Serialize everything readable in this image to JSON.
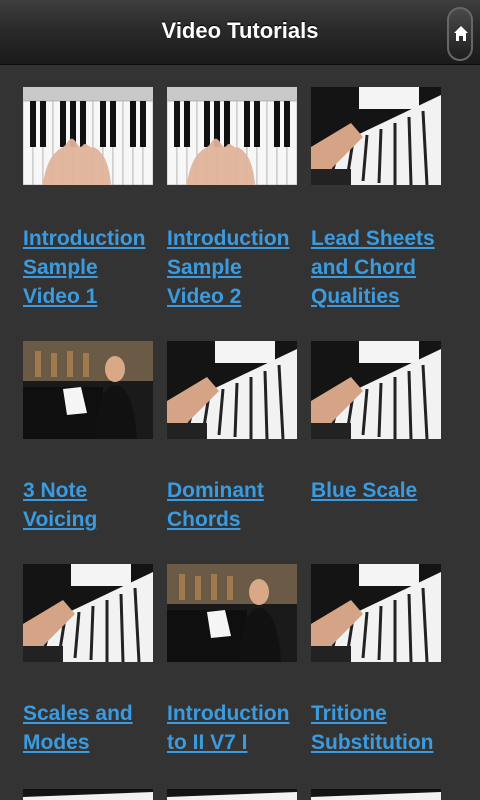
{
  "header": {
    "title": "Video Tutorials",
    "home_icon": "home-icon"
  },
  "videos": [
    {
      "title": "Introduction\nSample\nVideo 1",
      "thumb": "hands-on-keys"
    },
    {
      "title": "Introduction\nSample\nVideo 2",
      "thumb": "hands-on-keys"
    },
    {
      "title": "Lead Sheets\nand Chord\nQualities",
      "thumb": "piano-angle"
    },
    {
      "title": "3 Note\nVoicing",
      "thumb": "instructor"
    },
    {
      "title": "Dominant\nChords",
      "thumb": "piano-angle"
    },
    {
      "title": "Blue Scale",
      "thumb": "piano-angle"
    },
    {
      "title": "Scales and\nModes",
      "thumb": "piano-angle"
    },
    {
      "title": "Introduction\nto II V7 I",
      "thumb": "instructor"
    },
    {
      "title": "Tritione\nSubstitution",
      "thumb": "piano-angle"
    }
  ],
  "colors": {
    "background": "#333333",
    "link": "#3a9be0",
    "header": "#2a2a2a"
  }
}
